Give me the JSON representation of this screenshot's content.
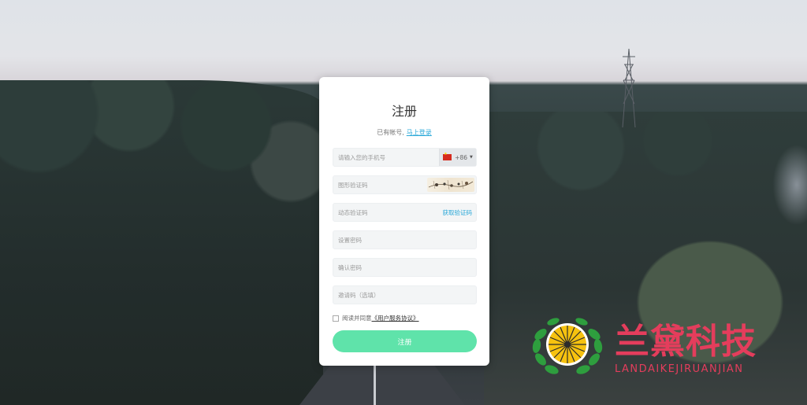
{
  "form": {
    "title": "注册",
    "have_account_text": "已有帐号,",
    "login_link": "马上登录",
    "phone_placeholder": "请输入您的手机号",
    "country_code": "+86",
    "captcha_placeholder": "图形验证码",
    "sms_code_placeholder": "动态验证码",
    "get_code_label": "获取验证码",
    "password_placeholder": "设置密码",
    "confirm_password_placeholder": "确认密码",
    "invite_placeholder": "邀请码（选填）",
    "agree_text": "阅读并同意",
    "agreement_link": "《用户服务协议》",
    "submit_label": "注册"
  },
  "watermark": {
    "name": "兰黛科技",
    "sub": "LANDAIKEJIRUANJIAN"
  },
  "colors": {
    "accent": "#5fe3aa",
    "link": "#2aa8d8",
    "brand": "#e43d5c"
  }
}
